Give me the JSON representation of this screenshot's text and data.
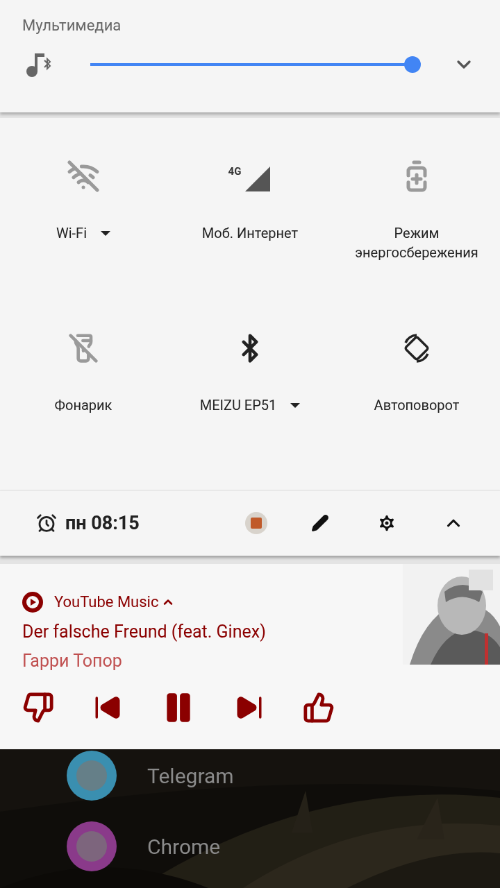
{
  "volume": {
    "title": "Мультимедиа",
    "level": 1
  },
  "tiles": [
    {
      "kind": "wifi",
      "label": "Wi-Fi",
      "on": false,
      "dropdown": true
    },
    {
      "kind": "mobile",
      "label": "Моб. Интернет",
      "network_type": "4G",
      "on": true,
      "dropdown": false
    },
    {
      "kind": "battery_saver",
      "label": "Режим энергосбережения",
      "on": false,
      "dropdown": false
    },
    {
      "kind": "flashlight",
      "label": "Фонарик",
      "on": false,
      "dropdown": false
    },
    {
      "kind": "bluetooth",
      "label": "MEIZU EP51",
      "on": true,
      "dropdown": true
    },
    {
      "kind": "rotation",
      "label": "Автоповорот",
      "on": true,
      "dropdown": false
    }
  ],
  "footer": {
    "alarm": "пн 08:15"
  },
  "notification": {
    "app": "YouTube Music",
    "expanded": true,
    "title": "Der falsche Freund (feat. Ginex)",
    "artist": "Гарри Топор",
    "playing": true
  },
  "home_apps": [
    {
      "label": "Telegram",
      "color": "#3a8fb0"
    },
    {
      "label": "Chrome",
      "color": "#8a3a8a"
    }
  ]
}
